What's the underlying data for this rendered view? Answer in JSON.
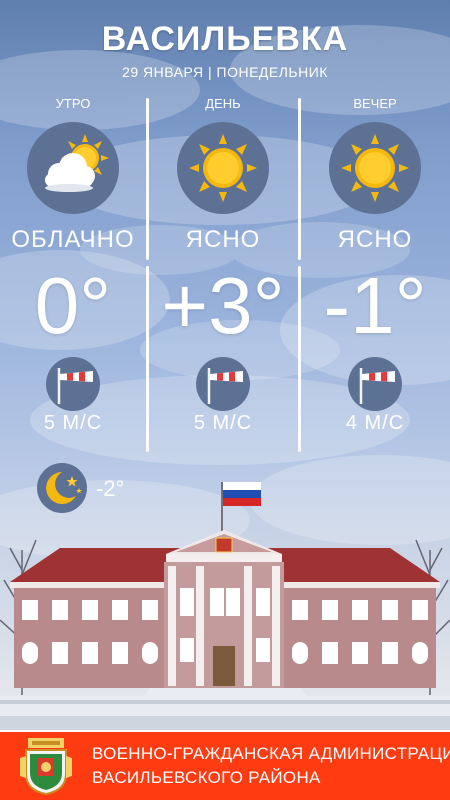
{
  "header": {
    "city": "ВАСИЛЬЕВКА",
    "date_line": "29 ЯНВАРЯ | ПОНЕДЕЛЬНИК"
  },
  "periods": [
    {
      "label": "УТРО",
      "condition": "ОБЛАЧНО",
      "temp": "0°",
      "wind": "5 М/С",
      "icon": "partly-cloudy-icon"
    },
    {
      "label": "ДЕНЬ",
      "condition": "ЯСНО",
      "temp": "+3°",
      "wind": "5 М/С",
      "icon": "sun-icon"
    },
    {
      "label": "ВЕЧЕР",
      "condition": "ЯСНО",
      "temp": "-1°",
      "wind": "4 М/С",
      "icon": "sun-icon"
    }
  ],
  "night": {
    "temp": "-2°",
    "icon": "moon-stars-icon"
  },
  "footer": {
    "line1": "ВОЕННО-ГРАЖДАНСКАЯ АДМИНИСТРАЦИЯ",
    "line2": "ВАСИЛЬЕВСКОГО РАЙОНА"
  },
  "colors": {
    "footer_bg": "#ff3b12",
    "sun": "#f5b80f",
    "icon_circle": "#5d7194",
    "building_wall": "#b88a8c"
  }
}
